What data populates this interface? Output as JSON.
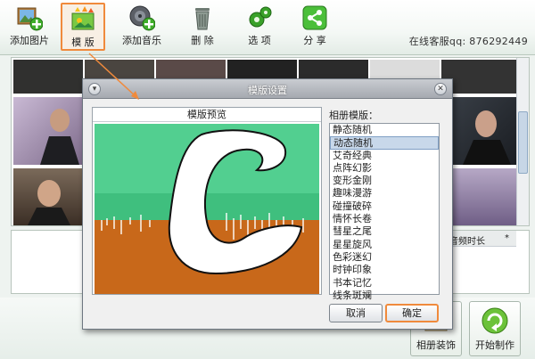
{
  "toolbar": {
    "buttons": [
      {
        "label": "添加图片",
        "icon": "add-picture-icon"
      },
      {
        "label": "模 版",
        "icon": "template-icon"
      },
      {
        "label": "添加音乐",
        "icon": "add-music-icon"
      },
      {
        "label": "删 除",
        "icon": "trash-icon"
      },
      {
        "label": "选 项",
        "icon": "gear-icon"
      },
      {
        "label": "分 享",
        "icon": "share-icon"
      }
    ],
    "hotline": "在线客服qq: 876292449"
  },
  "list": {
    "column_audio": "音频时长",
    "column_star": "*"
  },
  "bottom": {
    "decorate_label": "相册装饰",
    "start_label": "开始制作"
  },
  "dialog": {
    "title": "模版设置",
    "preview_caption": "模版预览",
    "templates_label": "相册模版：",
    "templates": [
      "静态随机",
      "动态随机",
      "艾奇经典",
      "点阵幻影",
      "变形金刚",
      "趣味漫游",
      "碰撞破碎",
      "情怀长卷",
      "彗星之尾",
      "星星旋风",
      "色彩迷幻",
      "时钟印象",
      "书本记忆",
      "线条斑斓"
    ],
    "selected_index": 1,
    "cancel_label": "取消",
    "ok_label": "确定"
  },
  "colors": {
    "accent": "#f08a3c",
    "preview_green": "#4fcf8f",
    "preview_orange": "#c8681a"
  }
}
